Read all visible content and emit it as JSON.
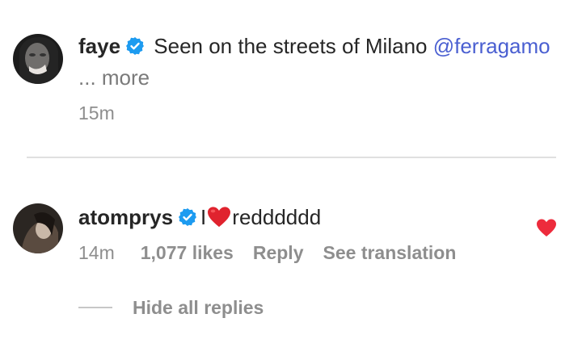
{
  "caption": {
    "username": "faye",
    "text": "Seen on the streets of Milano",
    "mention": "@ferragamo",
    "more": "... more",
    "time": "15m"
  },
  "reply": {
    "username": "atomprys",
    "text_before": "I",
    "text_after": "redddddd",
    "time": "14m",
    "likes": "1,077 likes",
    "reply_label": "Reply",
    "translate_label": "See translation"
  },
  "thread": {
    "hide_replies": "Hide all replies"
  },
  "colors": {
    "verified": "#1d9bf0",
    "heart": "#ed2b3c",
    "mention": "#4a5fd1"
  }
}
